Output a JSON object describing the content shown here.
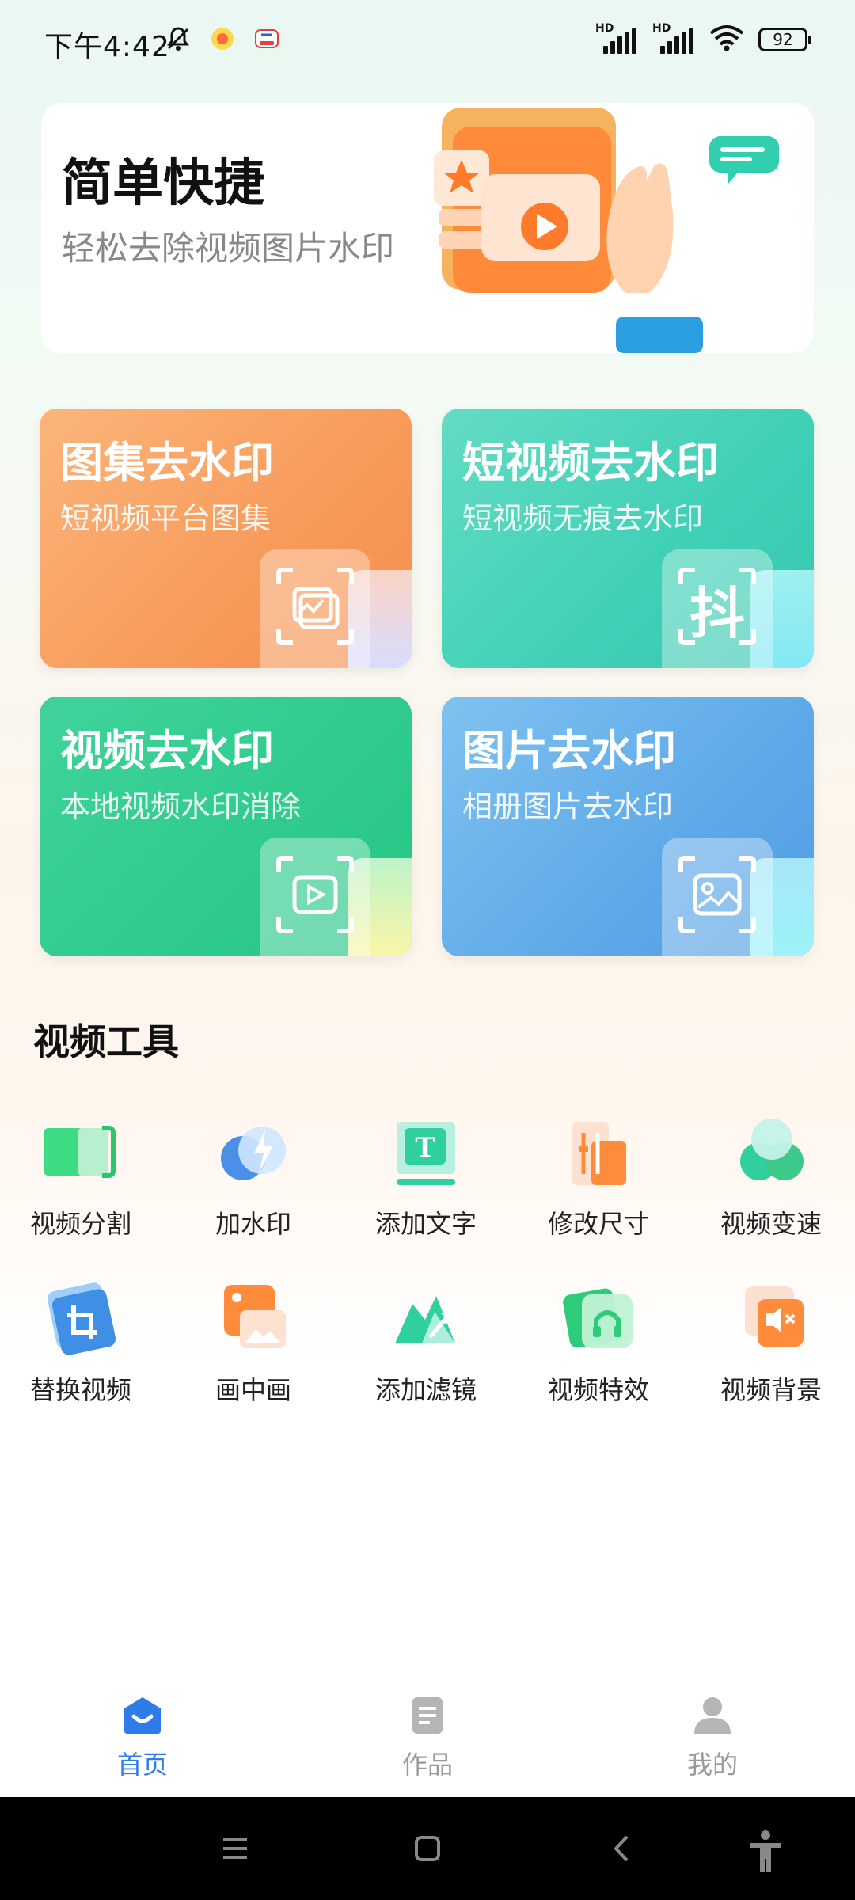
{
  "status_bar": {
    "time": "下午4:42",
    "battery": "92",
    "signal1_label": "HD",
    "signal2_label": "HD"
  },
  "banner": {
    "title": "简单快捷",
    "subtitle": "轻松去除视频图片水印"
  },
  "cards": [
    {
      "title": "图集去水印",
      "subtitle": "短视频平台图集",
      "icon": "gallery-icon"
    },
    {
      "title": "短视频去水印",
      "subtitle": "短视频无痕去水印",
      "icon": "douyin-icon",
      "icon_text": "抖"
    },
    {
      "title": "视频去水印",
      "subtitle": "本地视频水印消除",
      "icon": "play-icon"
    },
    {
      "title": "图片去水印",
      "subtitle": "相册图片去水印",
      "icon": "image-icon"
    }
  ],
  "section": {
    "title": "视频工具"
  },
  "tools": [
    {
      "label": "视频分割",
      "icon": "split-icon"
    },
    {
      "label": "加水印",
      "icon": "watermark-icon"
    },
    {
      "label": "添加文字",
      "icon": "text-icon"
    },
    {
      "label": "修改尺寸",
      "icon": "resize-icon"
    },
    {
      "label": "视频变速",
      "icon": "speed-icon"
    },
    {
      "label": "替换视频",
      "icon": "replace-icon"
    },
    {
      "label": "画中画",
      "icon": "pip-icon"
    },
    {
      "label": "添加滤镜",
      "icon": "filter-icon"
    },
    {
      "label": "视频特效",
      "icon": "effects-icon"
    },
    {
      "label": "视频背景",
      "icon": "background-icon"
    }
  ],
  "nav": {
    "home": "首页",
    "works": "作品",
    "mine": "我的"
  },
  "colors": {
    "accent": "#2f7bea",
    "inactive": "#9a9a9a"
  }
}
